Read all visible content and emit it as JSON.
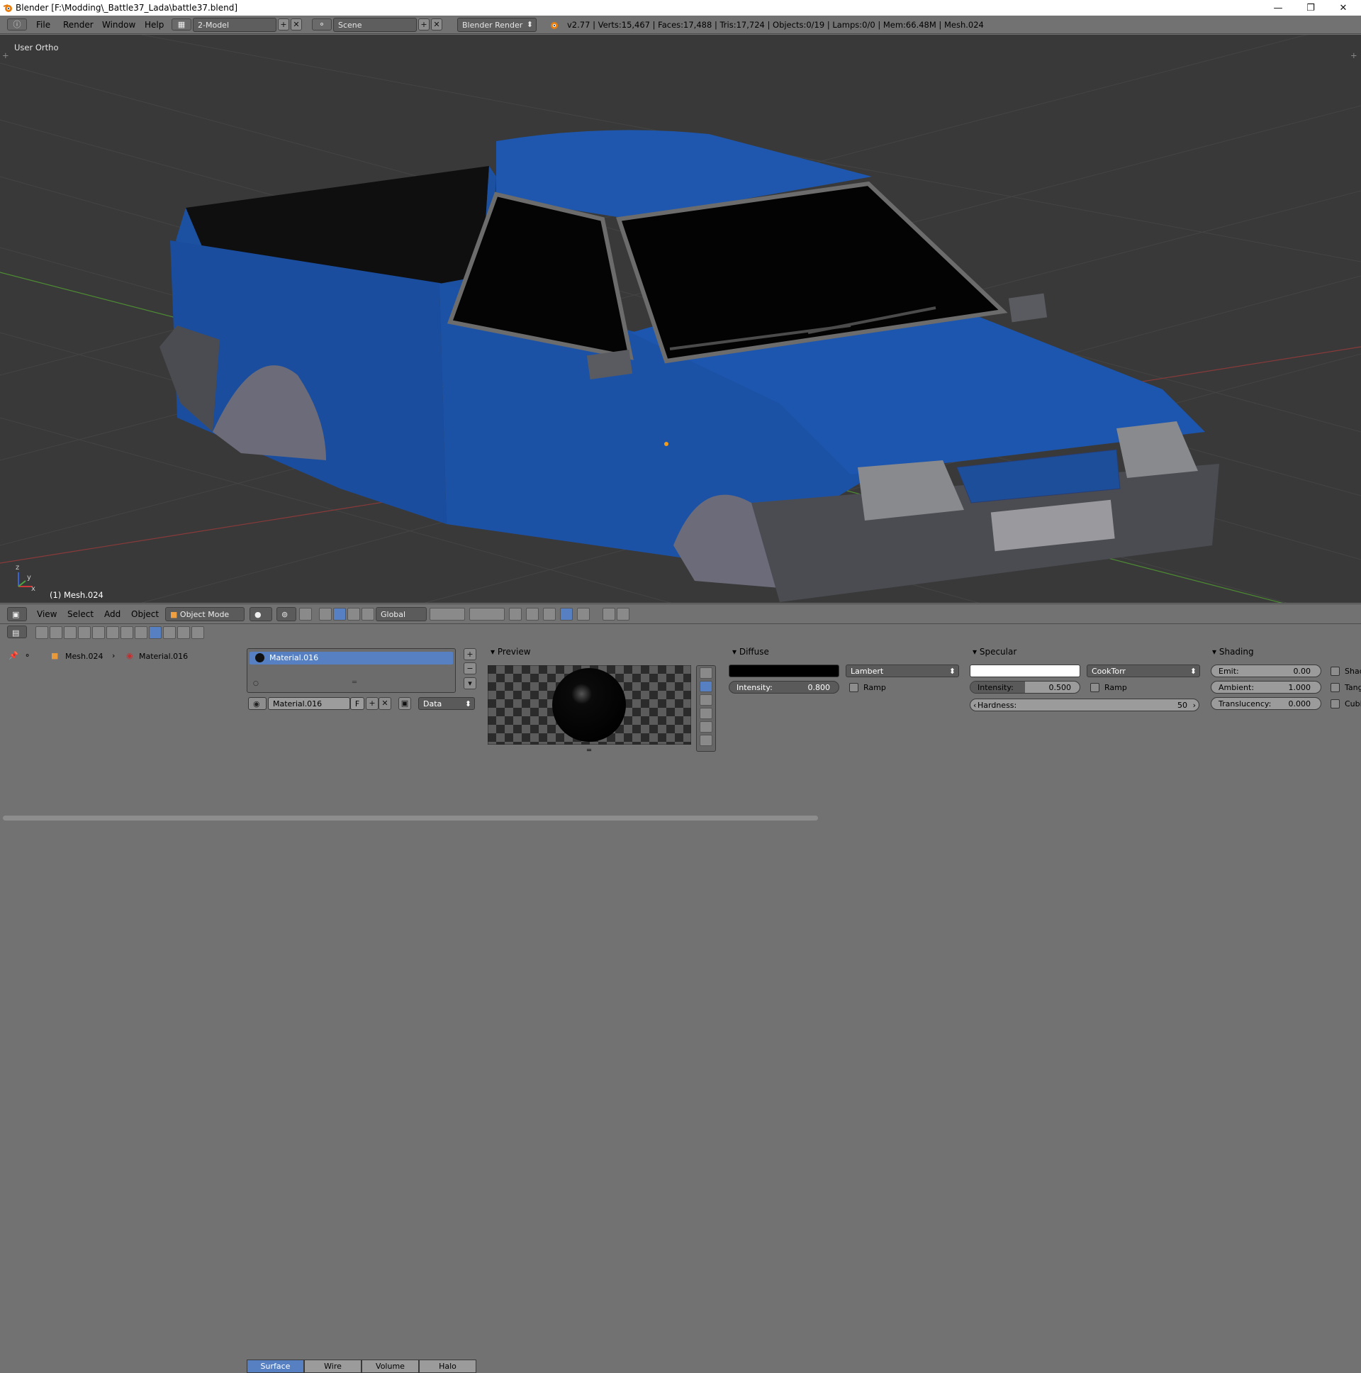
{
  "window": {
    "title": "Blender [F:\\Modding\\_Battle37_Lada\\battle37.blend]",
    "minimize": "—",
    "maximize": "❐",
    "close": "✕"
  },
  "infobar": {
    "menus": [
      "File",
      "Render",
      "Window",
      "Help"
    ],
    "screen_layout": "2-Model",
    "scene": "Scene",
    "render_engine": "Blender Render",
    "stats": "v2.77 | Verts:15,467 | Faces:17,488 | Tris:17,724 | Objects:0/19 | Lamps:0/0 | Mem:66.48M | Mesh.024"
  },
  "viewport": {
    "view_label": "User Ortho",
    "object_label": "(1) Mesh.024",
    "axis_x": "x",
    "axis_y": "y",
    "axis_z": "z"
  },
  "viewport_header": {
    "menus": [
      "View",
      "Select",
      "Add",
      "Object"
    ],
    "mode": "Object Mode",
    "orientation": "Global"
  },
  "properties": {
    "breadcrumb": {
      "object": "Mesh.024",
      "material": "Material.016"
    },
    "material_slot": "Material.016",
    "datablock_name": "Material.016",
    "fake_user": "F",
    "link": "Data",
    "tabs": [
      "Surface",
      "Wire",
      "Volume",
      "Halo"
    ],
    "active_tab": "Surface",
    "preview": {
      "header": "Preview"
    },
    "diffuse": {
      "header": "Diffuse",
      "color": "#000000",
      "shader": "Lambert",
      "intensity_label": "Intensity:",
      "intensity": "0.800",
      "ramp_label": "Ramp"
    },
    "specular": {
      "header": "Specular",
      "color": "#ffffff",
      "shader": "CookTorr",
      "intensity_label": "Intensity:",
      "intensity": "0.500",
      "intensity_fraction": 0.5,
      "ramp_label": "Ramp",
      "hardness_label": "Hardness:",
      "hardness": "50"
    },
    "shading": {
      "header": "Shading",
      "emit_label": "Emit:",
      "emit": "0.00",
      "ambient_label": "Ambient:",
      "ambient": "1.000",
      "translucency_label": "Translucency:",
      "translucency": "0.000",
      "checkbox_labels": [
        "Shad",
        "Tang",
        "Cubi"
      ]
    }
  },
  "colors": {
    "accent": "#5680c2",
    "car_body": "#1f54a6",
    "viewport_bg": "#393939"
  }
}
